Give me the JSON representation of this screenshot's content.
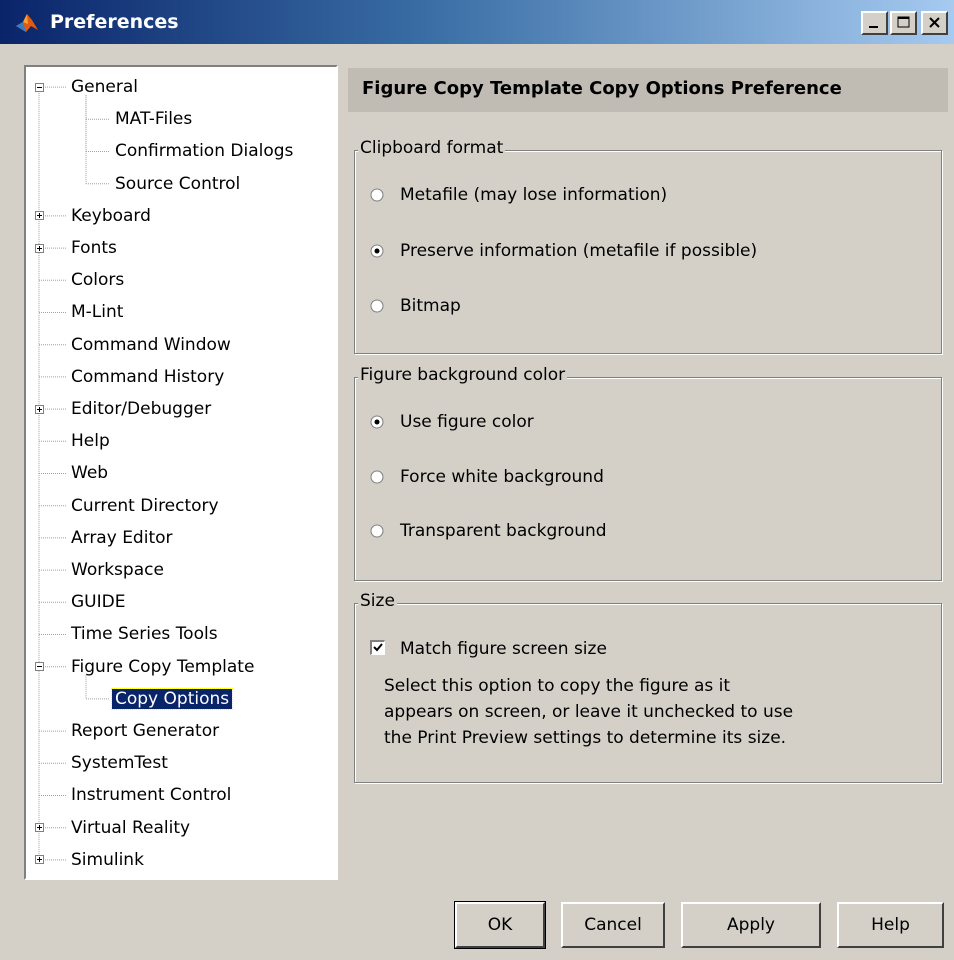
{
  "window": {
    "title": "Preferences",
    "controls": [
      "minimize-icon",
      "maximize-icon",
      "close-icon"
    ]
  },
  "tree": {
    "items": [
      {
        "label": "General",
        "level": 0,
        "expander": "minus"
      },
      {
        "label": "MAT-Files",
        "level": 1
      },
      {
        "label": "Confirmation Dialogs",
        "level": 1
      },
      {
        "label": "Source Control",
        "level": 1
      },
      {
        "label": "Keyboard",
        "level": 0,
        "expander": "plus"
      },
      {
        "label": "Fonts",
        "level": 0,
        "expander": "plus"
      },
      {
        "label": "Colors",
        "level": 0
      },
      {
        "label": "M-Lint",
        "level": 0
      },
      {
        "label": "Command Window",
        "level": 0
      },
      {
        "label": "Command History",
        "level": 0
      },
      {
        "label": "Editor/Debugger",
        "level": 0,
        "expander": "plus"
      },
      {
        "label": "Help",
        "level": 0
      },
      {
        "label": "Web",
        "level": 0
      },
      {
        "label": "Current Directory",
        "level": 0
      },
      {
        "label": "Array Editor",
        "level": 0
      },
      {
        "label": "Workspace",
        "level": 0
      },
      {
        "label": "GUIDE",
        "level": 0
      },
      {
        "label": "Time Series Tools",
        "level": 0
      },
      {
        "label": "Figure Copy Template",
        "level": 0,
        "expander": "minus"
      },
      {
        "label": "Copy Options",
        "level": 1,
        "selected": true
      },
      {
        "label": "Report Generator",
        "level": 0
      },
      {
        "label": "SystemTest",
        "level": 0
      },
      {
        "label": "Instrument Control",
        "level": 0
      },
      {
        "label": "Virtual Reality",
        "level": 0,
        "expander": "plus"
      },
      {
        "label": "Simulink",
        "level": 0,
        "expander": "plus"
      }
    ]
  },
  "content": {
    "heading": "Figure Copy Template Copy Options Preference",
    "clipboard": {
      "legend": "Clipboard format",
      "options": [
        {
          "label": "Metafile (may lose information)",
          "checked": false
        },
        {
          "label": "Preserve information (metafile if possible)",
          "checked": true
        },
        {
          "label": "Bitmap",
          "checked": false
        }
      ]
    },
    "background": {
      "legend": "Figure background color",
      "options": [
        {
          "label": "Use figure color",
          "checked": true
        },
        {
          "label": "Force white background",
          "checked": false
        },
        {
          "label": "Transparent background",
          "checked": false
        }
      ]
    },
    "size": {
      "legend": "Size",
      "checkbox_label": "Match figure screen size",
      "checked": true,
      "description": [
        "Select this option to copy the figure as it",
        "appears on screen, or leave it unchecked to use",
        "the Print Preview settings to determine its size."
      ]
    }
  },
  "buttons": {
    "ok": "OK",
    "cancel": "Cancel",
    "apply": "Apply",
    "help": "Help"
  },
  "colors": {
    "titlebar_start": "#0a246a",
    "titlebar_end": "#a6caf0",
    "selection": "#0a246a",
    "dialog_bg": "#d4d0c8"
  }
}
